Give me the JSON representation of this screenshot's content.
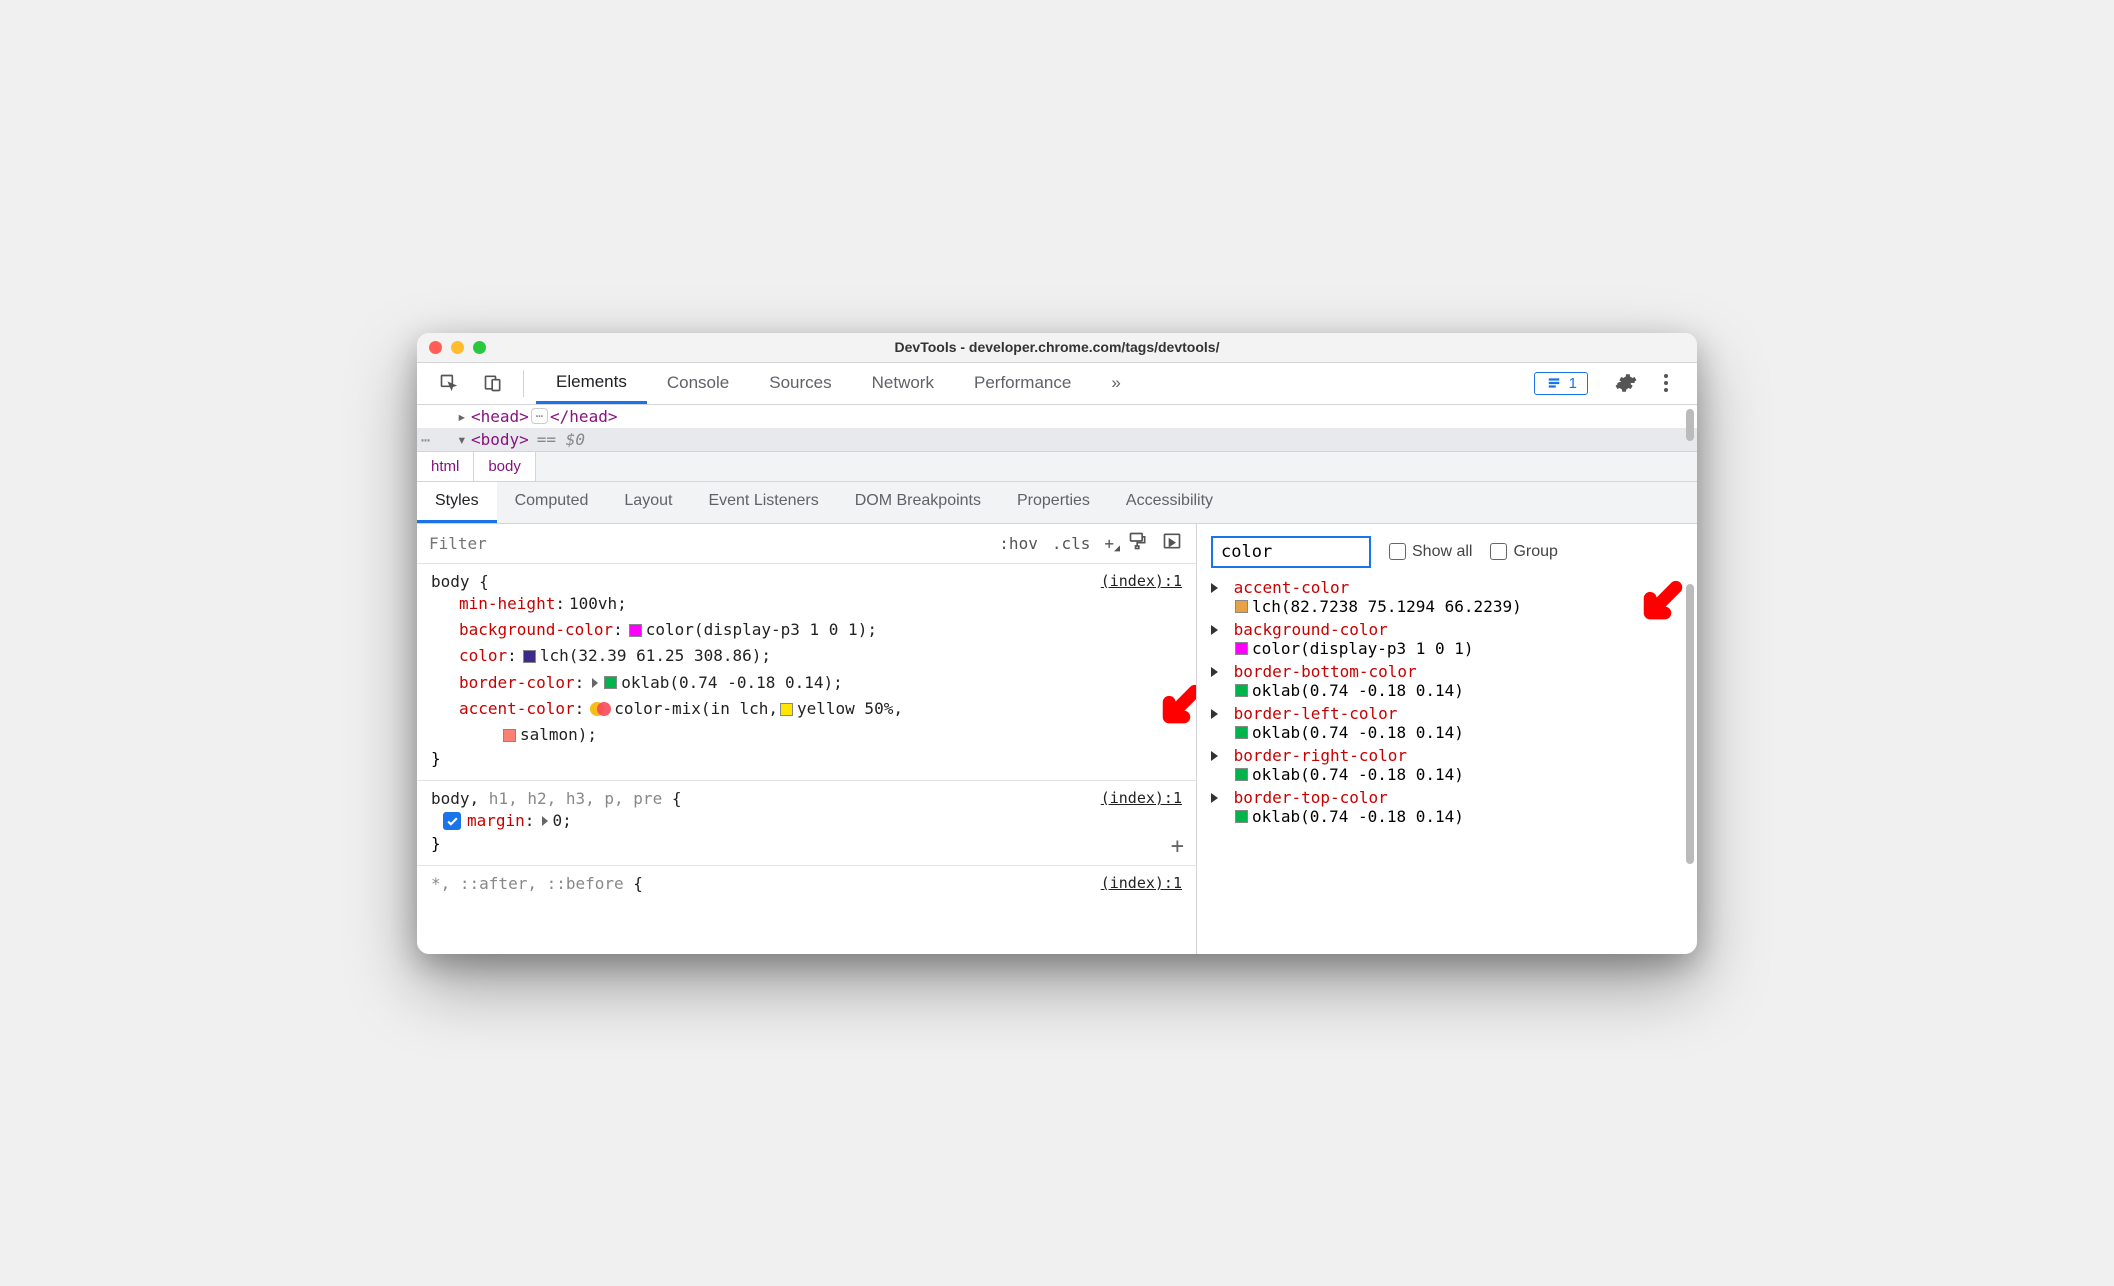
{
  "window": {
    "title": "DevTools - developer.chrome.com/tags/devtools/"
  },
  "toolbar": {
    "tabs": [
      "Elements",
      "Console",
      "Sources",
      "Network",
      "Performance"
    ],
    "active_tab": "Elements",
    "issues_count": "1"
  },
  "dom": {
    "head_open": "<head>",
    "head_close": "</head>",
    "body_open": "<body>",
    "dollar_label": "== $0"
  },
  "breadcrumbs": [
    "html",
    "body"
  ],
  "sub_tabs": [
    "Styles",
    "Computed",
    "Layout",
    "Event Listeners",
    "DOM Breakpoints",
    "Properties",
    "Accessibility"
  ],
  "active_sub_tab": "Styles",
  "styles": {
    "filter_placeholder": "Filter",
    "hov": ":hov",
    "cls": ".cls",
    "rules": [
      {
        "selector_main": "body",
        "selector_dim": "",
        "source": "(index):1",
        "declarations": [
          {
            "prop": "min-height",
            "value_text": "100vh",
            "swatch": null
          },
          {
            "prop": "background-color",
            "value_text": "color(display-p3 1 0 1)",
            "swatch": "#ff00ff"
          },
          {
            "prop": "color",
            "value_text": "lch(32.39 61.25 308.86)",
            "swatch": "#3d2a8a"
          },
          {
            "prop": "border-color",
            "value_text": "oklab(0.74 -0.18 0.14)",
            "swatch": "#00b44b",
            "expandable": true
          },
          {
            "prop": "accent-color",
            "value_text": "color-mix(in lch, ",
            "swatch": "overlap",
            "tail": [
              {
                "swatch": "#ffe600",
                "text": "yellow 50%,"
              },
              {
                "swatch": "#fa8072",
                "text": "salmon);"
              }
            ]
          }
        ]
      },
      {
        "selector_main": "body,",
        "selector_dim": " h1, h2, h3, p, pre",
        "source": "(index):1",
        "declarations": [
          {
            "prop": "margin",
            "value_text": "0",
            "swatch": null,
            "checked": true,
            "expandable": true
          }
        ]
      },
      {
        "selector_main": "",
        "selector_dim": "*, ::after, ::before",
        "source": "(index):1",
        "declarations": []
      }
    ]
  },
  "computed": {
    "filter_value": "color",
    "show_all_label": "Show all",
    "group_label": "Group",
    "props": [
      {
        "name": "accent-color",
        "value": "lch(82.7238 75.1294 66.2239)",
        "swatch": "#e8a243"
      },
      {
        "name": "background-color",
        "value": "color(display-p3 1 0 1)",
        "swatch": "#ff00ff"
      },
      {
        "name": "border-bottom-color",
        "value": "oklab(0.74 -0.18 0.14)",
        "swatch": "#00b44b"
      },
      {
        "name": "border-left-color",
        "value": "oklab(0.74 -0.18 0.14)",
        "swatch": "#00b44b"
      },
      {
        "name": "border-right-color",
        "value": "oklab(0.74 -0.18 0.14)",
        "swatch": "#00b44b"
      },
      {
        "name": "border-top-color",
        "value": "oklab(0.74 -0.18 0.14)",
        "swatch": "#00b44b"
      }
    ]
  }
}
